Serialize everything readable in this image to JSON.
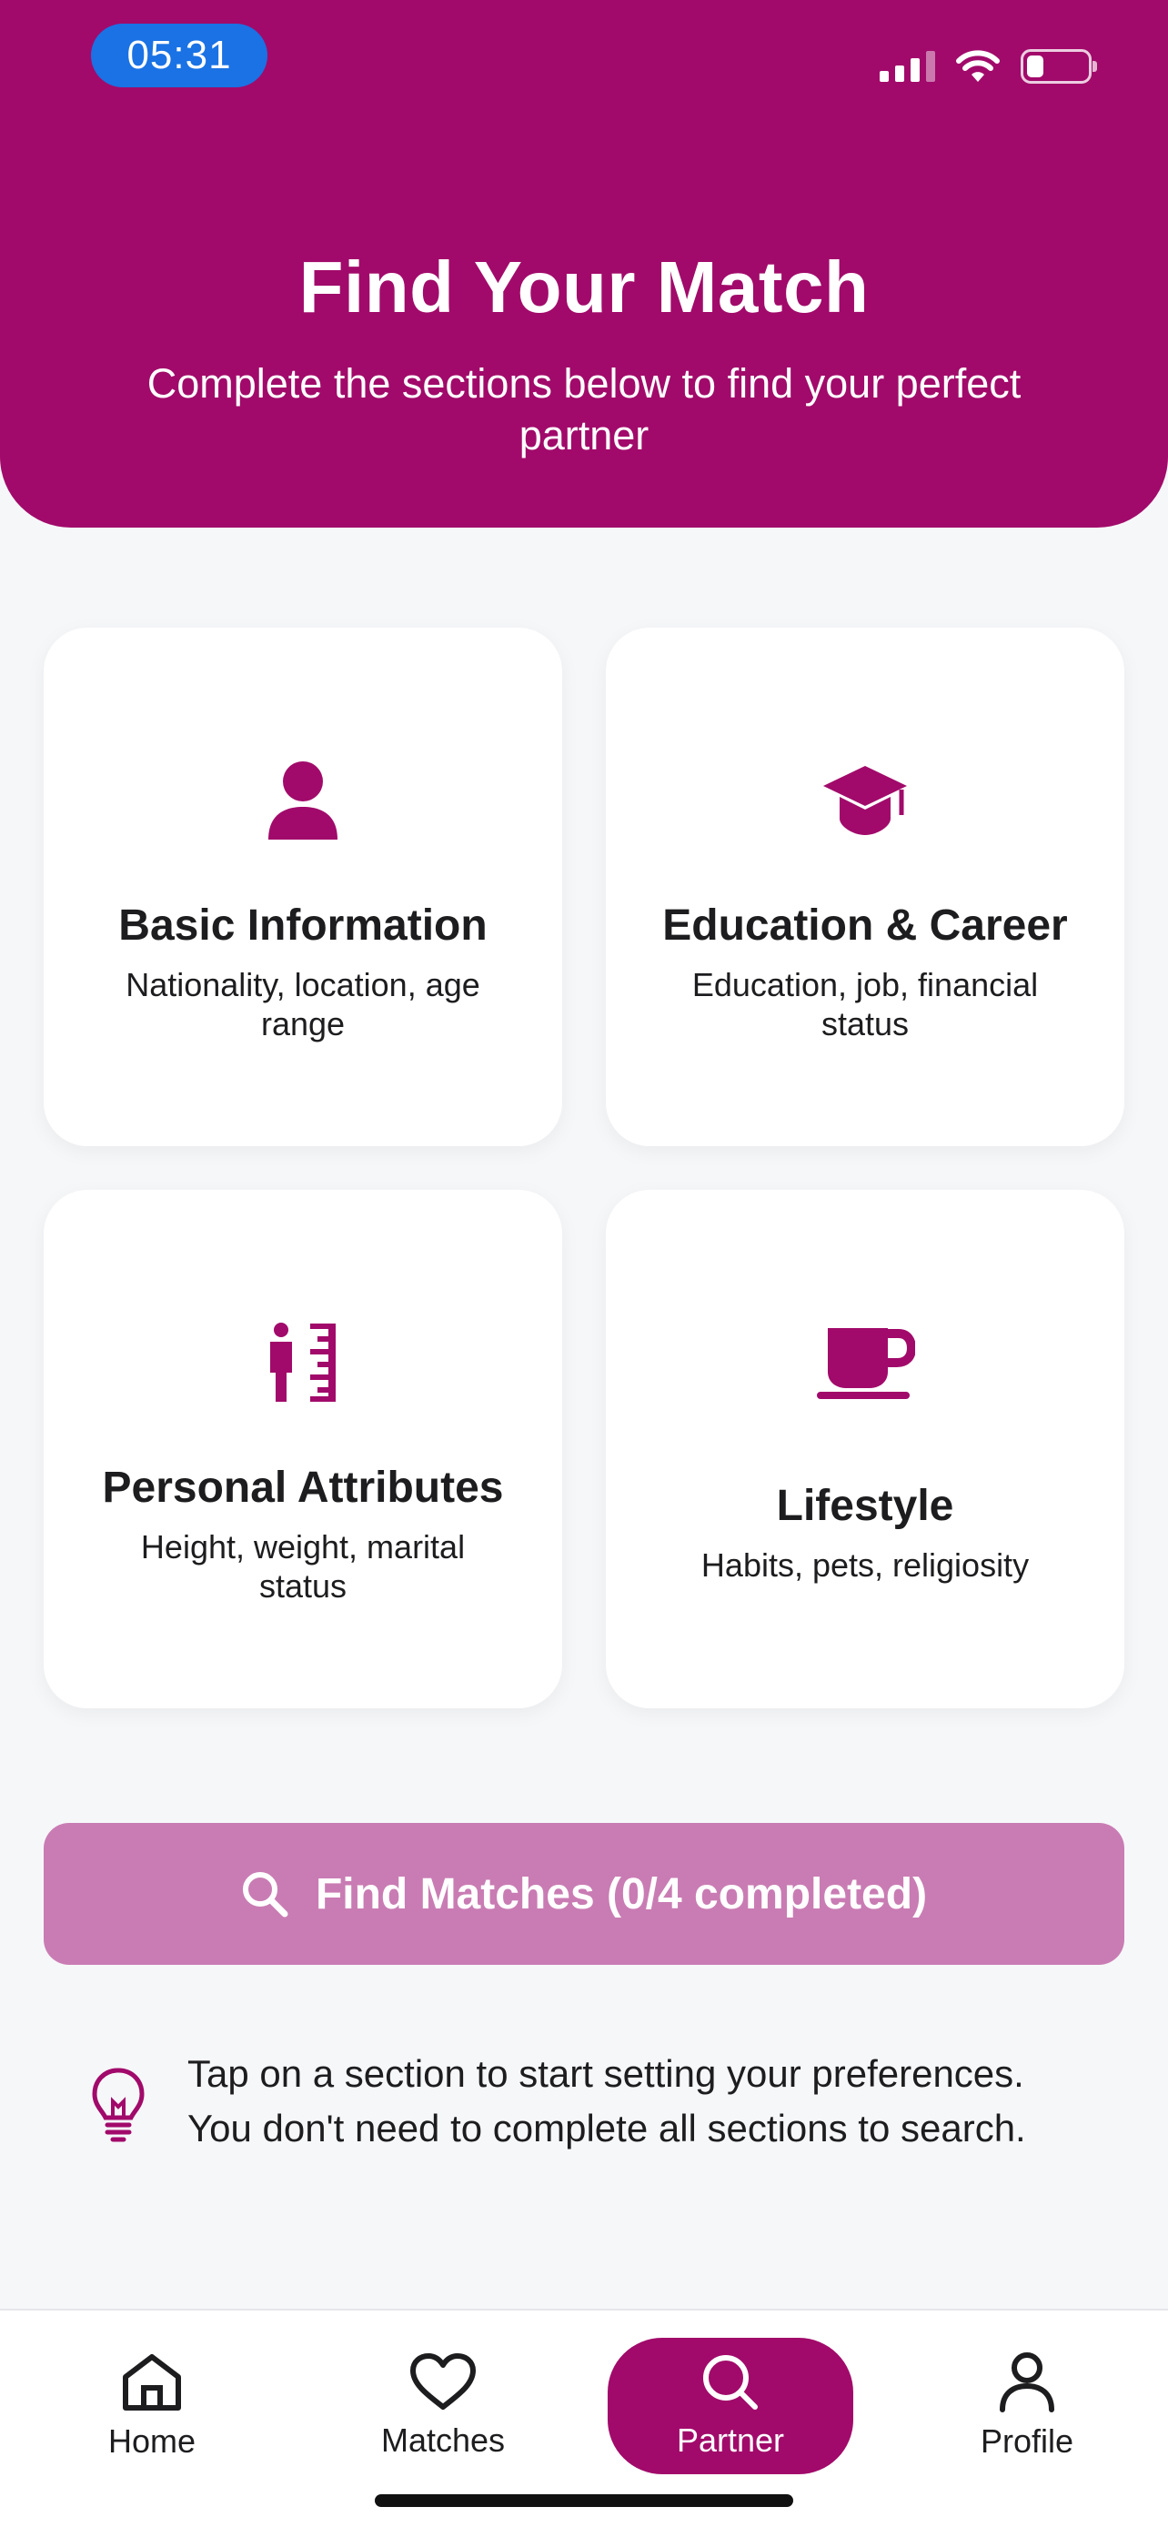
{
  "status_bar": {
    "time": "05:31"
  },
  "header": {
    "title": "Find Your Match",
    "subtitle": "Complete the sections below to find your perfect partner"
  },
  "sections": [
    {
      "title": "Basic Information",
      "description": "Nationality, location, age range",
      "icon": "person-icon"
    },
    {
      "title": "Education & Career",
      "description": "Education, job, financial status",
      "icon": "graduation-cap-icon"
    },
    {
      "title": "Personal Attributes",
      "description": "Height, weight, marital status",
      "icon": "height-ruler-icon"
    },
    {
      "title": "Lifestyle",
      "description": "Habits, pets, religiosity",
      "icon": "coffee-cup-icon"
    }
  ],
  "find_button": {
    "label": "Find Matches (0/4 completed)"
  },
  "tip": {
    "line1": "Tap on a section to start setting your preferences.",
    "line2": "You don't need to complete all sections to search."
  },
  "tabs": [
    {
      "label": "Home",
      "icon": "home-icon"
    },
    {
      "label": "Matches",
      "icon": "heart-icon"
    },
    {
      "label": "Partner",
      "icon": "search-icon",
      "active": true
    },
    {
      "label": "Profile",
      "icon": "person-outline-icon"
    }
  ],
  "colors": {
    "primary": "#a10a6a",
    "button_disabled": "#c97cb3",
    "background": "#f6f7f9"
  }
}
